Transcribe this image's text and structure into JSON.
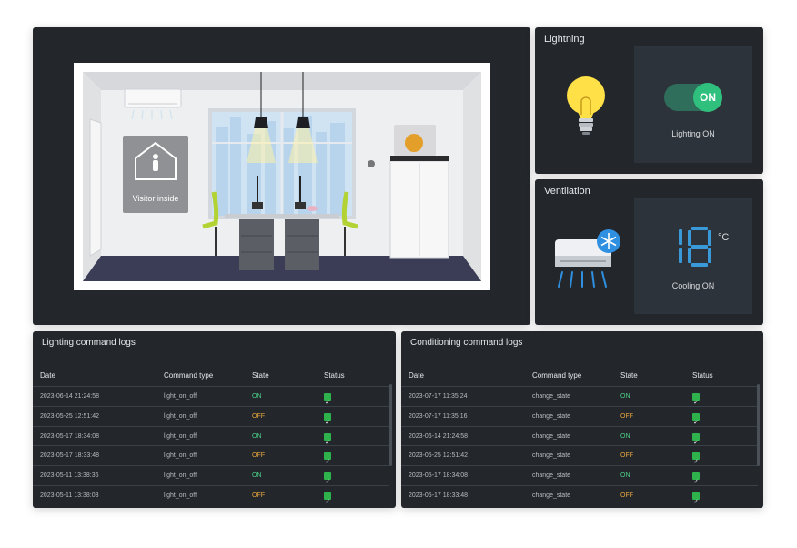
{
  "room": {
    "visitor_label": "Visitor inside"
  },
  "lighting": {
    "title": "Lightning",
    "toggle_label": "ON",
    "status": "Lighting ON"
  },
  "ventilation": {
    "title": "Ventilation",
    "temperature": "18",
    "unit": "°C",
    "status": "Cooling ON"
  },
  "columns": {
    "date": "Date",
    "command_type": "Command type",
    "state": "State",
    "status": "Status"
  },
  "lighting_logs": {
    "title": "Lighting command logs",
    "rows": [
      {
        "date": "2023-06-14 21:24:58",
        "command": "light_on_off",
        "state": "ON"
      },
      {
        "date": "2023-05-25 12:51:42",
        "command": "light_on_off",
        "state": "OFF"
      },
      {
        "date": "2023-05-17 18:34:08",
        "command": "light_on_off",
        "state": "ON"
      },
      {
        "date": "2023-05-17 18:33:48",
        "command": "light_on_off",
        "state": "OFF"
      },
      {
        "date": "2023-05-11 13:38:36",
        "command": "light_on_off",
        "state": "ON"
      },
      {
        "date": "2023-05-11 13:38:03",
        "command": "light_on_off",
        "state": "OFF"
      }
    ]
  },
  "conditioning_logs": {
    "title": "Conditioning command logs",
    "rows": [
      {
        "date": "2023-07-17 11:35:24",
        "command": "change_state",
        "state": "ON"
      },
      {
        "date": "2023-07-17 11:35:16",
        "command": "change_state",
        "state": "OFF"
      },
      {
        "date": "2023-06-14 21:24:58",
        "command": "change_state",
        "state": "ON"
      },
      {
        "date": "2023-05-25 12:51:42",
        "command": "change_state",
        "state": "OFF"
      },
      {
        "date": "2023-05-17 18:34:08",
        "command": "change_state",
        "state": "ON"
      },
      {
        "date": "2023-05-17 18:33:48",
        "command": "change_state",
        "state": "OFF"
      }
    ]
  },
  "colors": {
    "panel": "#23272c",
    "accent_on": "#30c07e",
    "state_on": "#4cd187",
    "state_off": "#e7a53c",
    "segment": "#3a9ad9"
  }
}
